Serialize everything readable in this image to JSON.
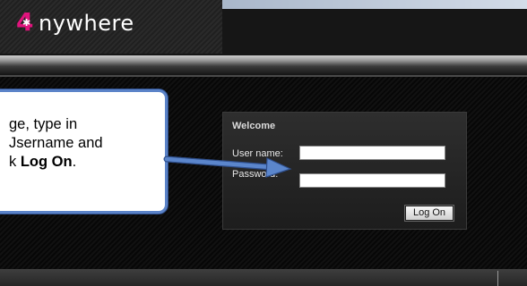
{
  "app": {
    "logo_mark": "4",
    "logo_text": "nywhere"
  },
  "login": {
    "title": "Welcome",
    "username_label": "User name:",
    "password_label": "Password:",
    "username_value": "",
    "password_value": "",
    "logon_button": "Log On"
  },
  "callout": {
    "line1": "ge, type in",
    "line2": "Jsername and",
    "line3_prefix": "k ",
    "line3_bold": "Log On",
    "line3_suffix": "."
  },
  "colors": {
    "brand_accent": "#e0147d",
    "callout_border": "#5b83c8",
    "arrow": "#4f79c0"
  }
}
